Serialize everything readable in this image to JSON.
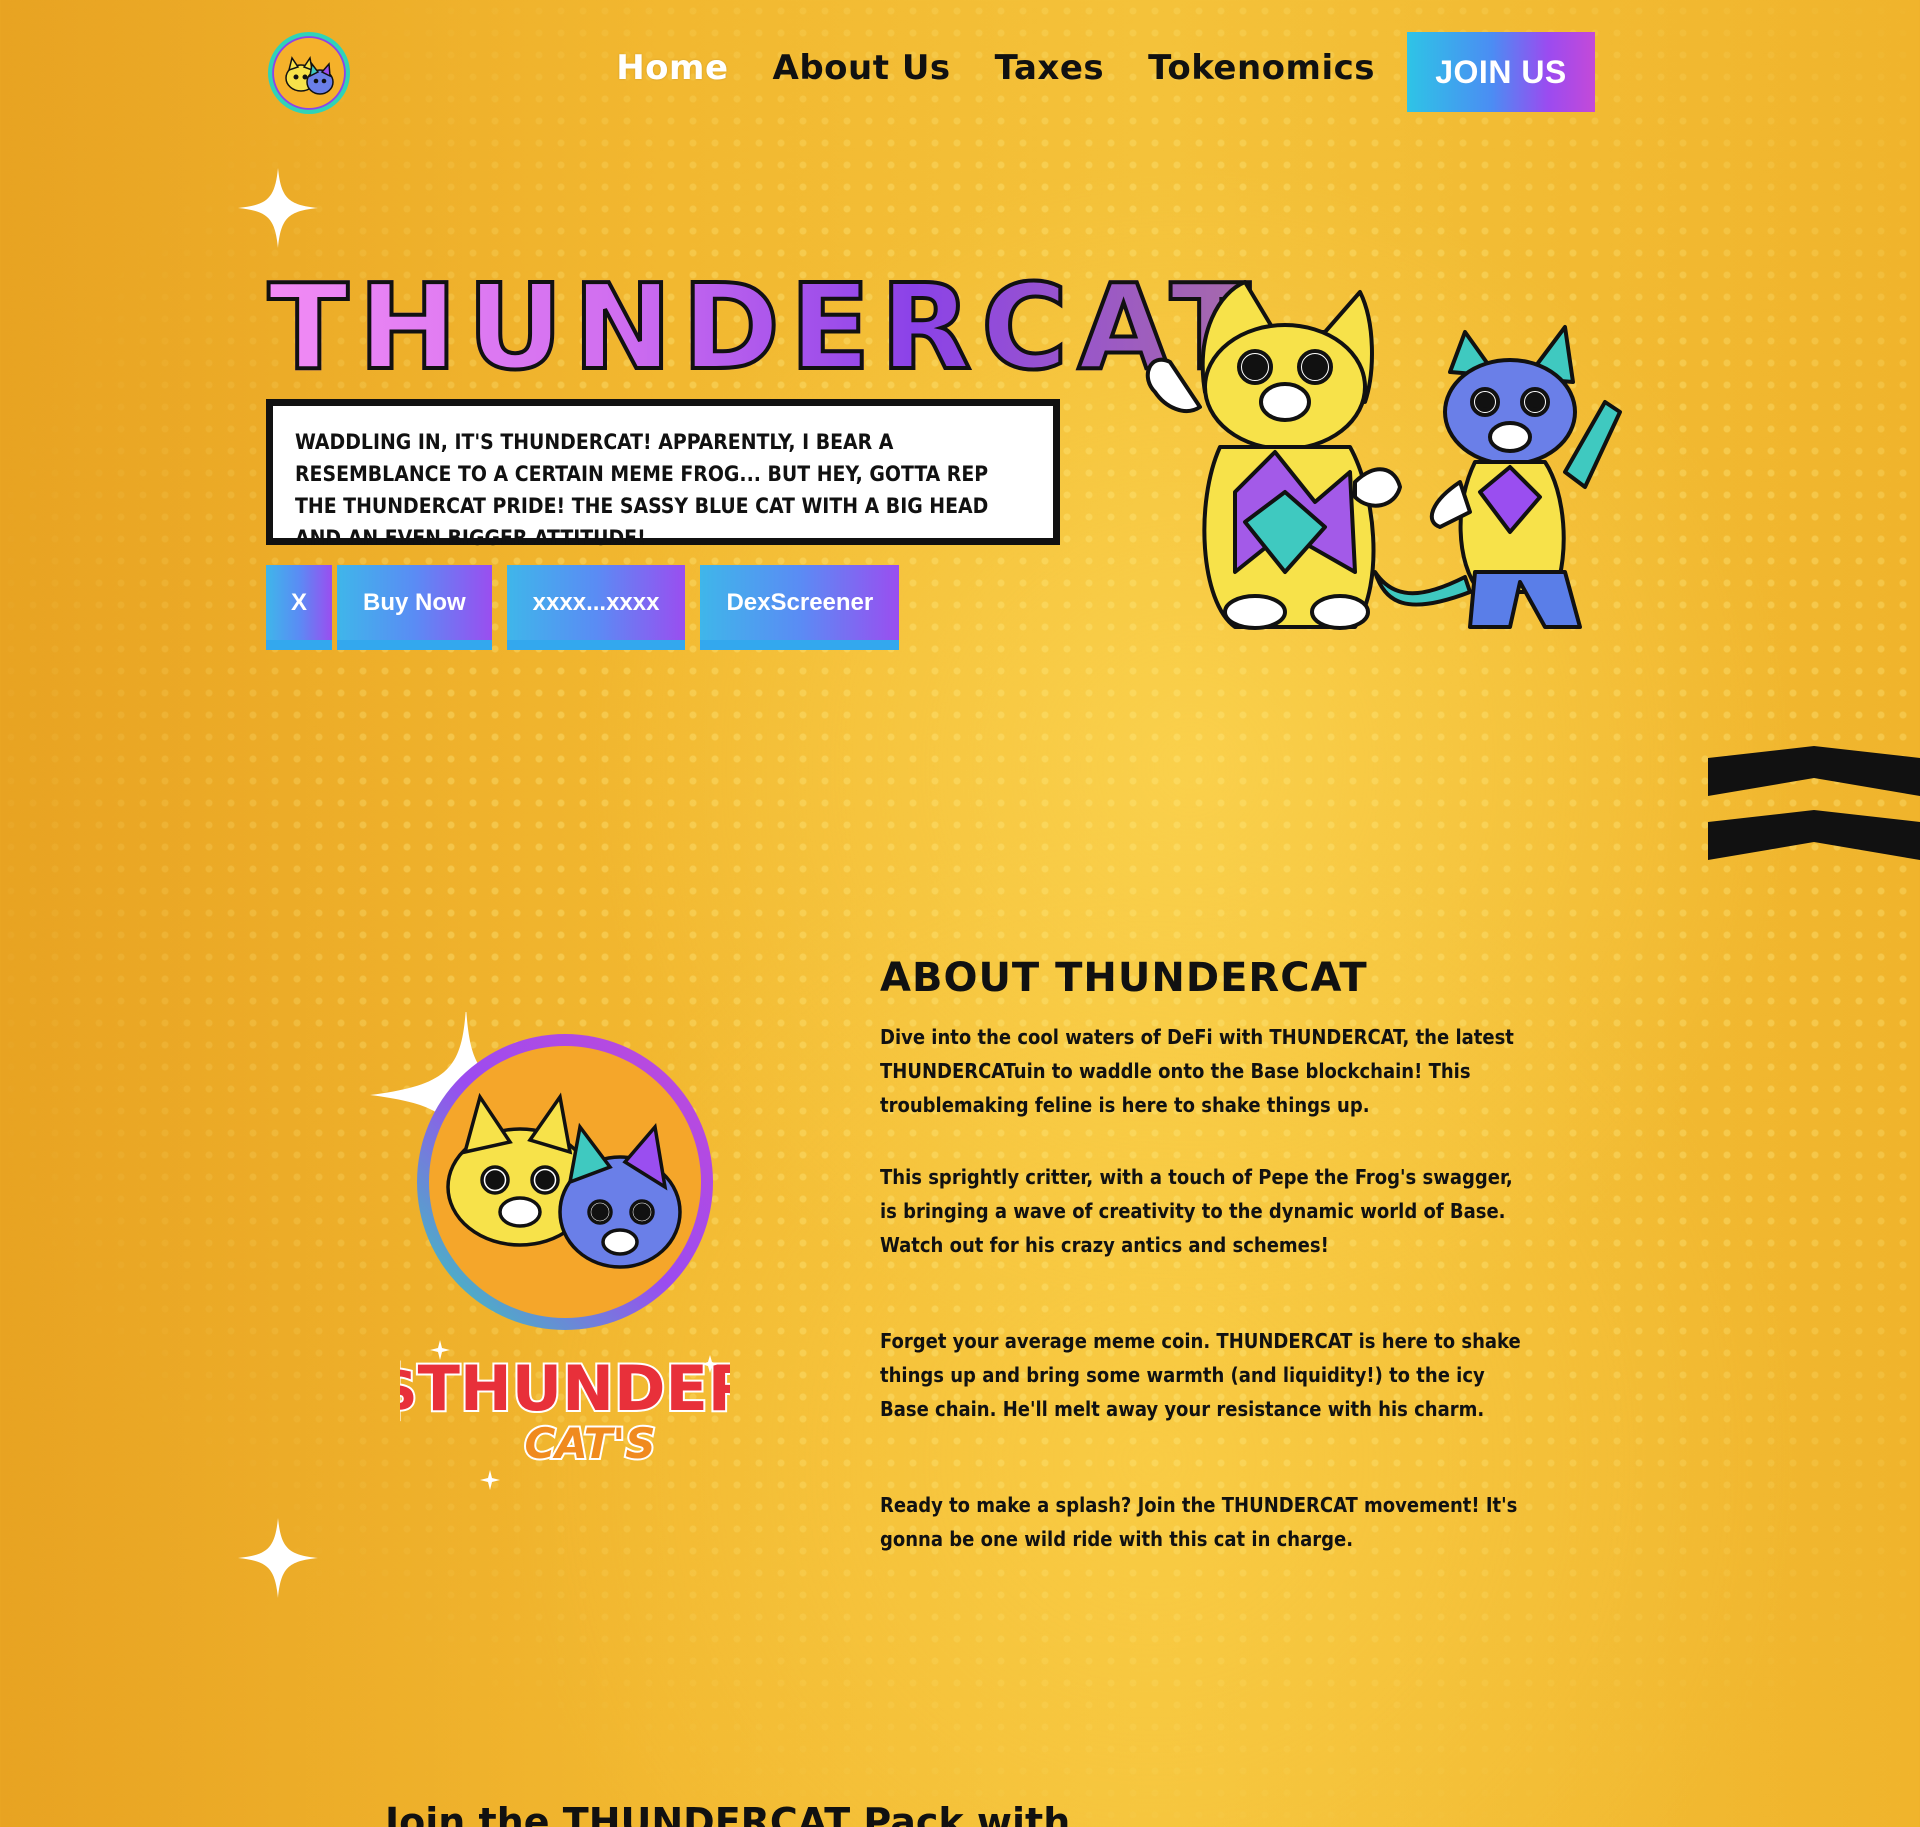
{
  "nav": {
    "logo_alt": "Thundercat logo",
    "links": [
      {
        "label": "Home",
        "active": true
      },
      {
        "label": "About Us",
        "active": false
      },
      {
        "label": "Taxes",
        "active": false
      },
      {
        "label": "Tokenomics",
        "active": false
      }
    ],
    "cta_label": "JOIN US"
  },
  "hero": {
    "title": "THUNDERCAT",
    "tagline": "Waddling in, it's THUNDERCAT! Apparently, I bear a resemblance to a certain meme frog... but hey, gotta rep the THUNDERCAT pride! The sassy blue cat with a big head and an even bigger attitude!",
    "buttons": [
      {
        "label": "X"
      },
      {
        "label": "Buy Now"
      },
      {
        "label": "xxxx...xxxx"
      },
      {
        "label": "DexScreener"
      }
    ]
  },
  "about": {
    "title": "ABOUT THUNDERCAT",
    "paragraphs": [
      "Dive into the cool waters of DeFi with THUNDERCAT, the latest THUNDERCATuin to waddle onto the Base blockchain! This troublemaking feline is here to shake things up.",
      "This sprightly critter, with a touch of Pepe the Frog's swagger, is bringing a wave of creativity to the dynamic world of Base. Watch out for his crazy antics and schemes!",
      "Forget your average meme coin. THUNDERCAT is here to shake things up and bring some warmth (and liquidity!) to the icy Base chain. He'll melt away your resistance with his charm.",
      "Ready to make a splash? Join the THUNDERCAT movement! It's gonna be one wild ride with this cat in charge."
    ],
    "emblem_text_top": "$THUNDER",
    "emblem_text_bottom": "CAT'S"
  },
  "next_section": {
    "heading": "Join the THUNDERCAT Pack with"
  },
  "colors": {
    "background": "#f2b830",
    "accent_gradient_start": "#2ec4e6",
    "accent_gradient_end": "#c44ad8",
    "title_pink": "#f28bf5",
    "title_purple": "#8b42e8",
    "text": "#111111",
    "active_nav": "#ffffff"
  }
}
